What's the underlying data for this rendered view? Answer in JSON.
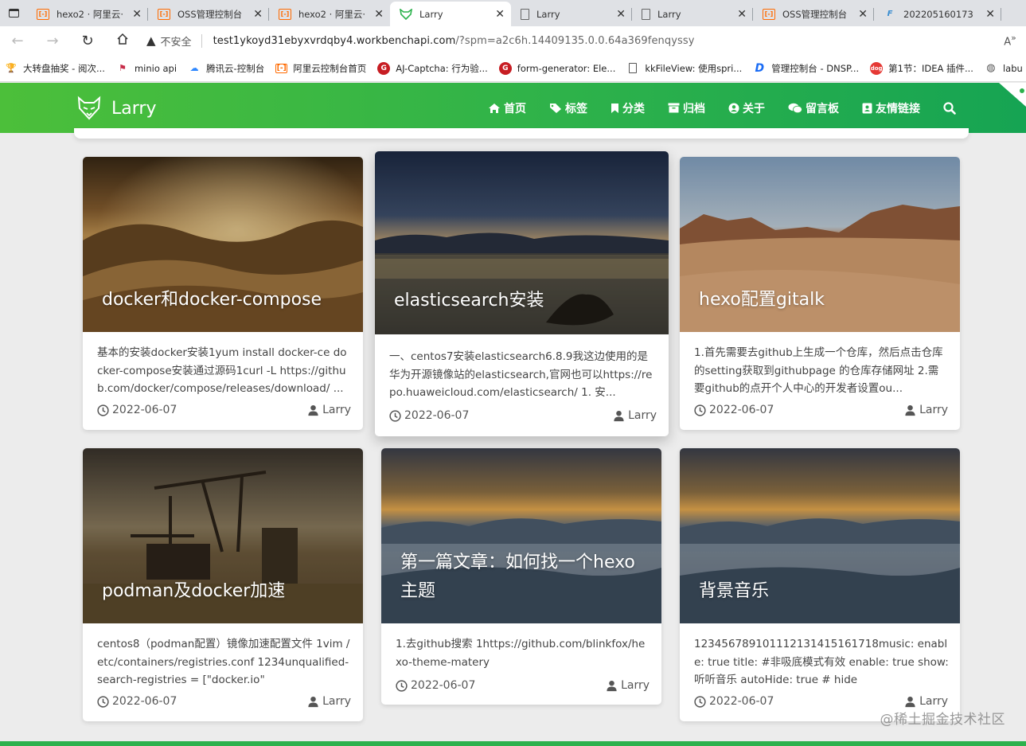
{
  "browser": {
    "tabs": [
      {
        "title": "hexo2 · 阿里云·",
        "favicon": "aliyun-icon",
        "active": false
      },
      {
        "title": "OSS管理控制台",
        "favicon": "aliyun-icon",
        "active": false
      },
      {
        "title": "hexo2 · 阿里云·",
        "favicon": "aliyun-icon",
        "active": false
      },
      {
        "title": "Larry",
        "favicon": "larry-icon",
        "active": true
      },
      {
        "title": "Larry",
        "favicon": "page-icon",
        "active": false
      },
      {
        "title": "Larry",
        "favicon": "page-icon",
        "active": false
      },
      {
        "title": "OSS管理控制台",
        "favicon": "aliyun-icon",
        "active": false
      },
      {
        "title": "202205160173",
        "favicon": "feather-icon",
        "active": false
      }
    ],
    "security_label": "不安全",
    "url_host": "test1ykoyd31ebyxvrdqby4.workbenchapi.com",
    "url_path": "/?spm=a2c6h.14409135.0.0.64a369fenqyssy",
    "bookmarks": [
      {
        "label": "大转盘抽奖 - 阅次...",
        "icon": "trophy-icon"
      },
      {
        "label": "minio api",
        "icon": "bird-icon"
      },
      {
        "label": "腾讯云-控制台",
        "icon": "cloud-icon"
      },
      {
        "label": "阿里云控制台首页",
        "icon": "aliyun-icon"
      },
      {
        "label": "AJ-Captcha: 行为验...",
        "icon": "gitee-icon"
      },
      {
        "label": "form-generator: Ele...",
        "icon": "gitee-icon"
      },
      {
        "label": "kkFileView: 使用spri...",
        "icon": "page-icon"
      },
      {
        "label": "管理控制台 - DNSP...",
        "icon": "dnspod-icon"
      },
      {
        "label": "第1节：IDEA 插件...",
        "icon": "dogo-icon"
      },
      {
        "label": "labu",
        "icon": "globe-icon"
      }
    ]
  },
  "site": {
    "title": "Larry",
    "nav": [
      {
        "label": "首页",
        "icon": "home-icon"
      },
      {
        "label": "标签",
        "icon": "tags-icon"
      },
      {
        "label": "分类",
        "icon": "bookmark-icon"
      },
      {
        "label": "归档",
        "icon": "archive-icon"
      },
      {
        "label": "关于",
        "icon": "user-circle-icon"
      },
      {
        "label": "留言板",
        "icon": "comments-icon"
      },
      {
        "label": "友情链接",
        "icon": "address-book-icon"
      }
    ]
  },
  "posts": [
    {
      "title": "docker和docker-compose",
      "summary": "基本的安装docker安装1yum install docker-ce docker-compose安装通过源码1curl -L https://github.com/docker/compose/releases/download/ ...",
      "date": "2022-06-07",
      "author": "Larry"
    },
    {
      "title": "elasticsearch安装",
      "summary": "一、centos7安装elasticsearch6.8.9我这边使用的是华为开源镜像站的elasticsearch,官网也可以https://repo.huaweicloud.com/elasticsearch/ 1. 安...",
      "date": "2022-06-07",
      "author": "Larry"
    },
    {
      "title": "hexo配置gitalk",
      "summary": "1.首先需要去github上生成一个仓库，然后点击仓库的setting获取到githubpage 的仓库存储网址 2.需要github的点开个人中心的开发者设置ou...",
      "date": "2022-06-07",
      "author": "Larry"
    },
    {
      "title": "podman及docker加速",
      "summary": "centos8（podman配置）镜像加速配置文件 1vim /etc/containers/registries.conf 1234unqualified-search-registries = [\"docker.io\"",
      "date": "2022-06-07",
      "author": "Larry"
    },
    {
      "title": "第一篇文章：如何找一个hexo主题",
      "summary": "1.去github搜索 1https://github.com/blinkfox/hexo-theme-matery",
      "date": "2022-06-07",
      "author": "Larry"
    },
    {
      "title": "背景音乐",
      "summary": "123456789101112131415161718music:   enable: true title: #非吸底模式有效 enable: true show: 听听音乐 autoHide: true # hide",
      "date": "2022-06-07",
      "author": "Larry"
    }
  ],
  "watermark": "@稀土掘金技术社区",
  "colors": {
    "header_start": "#4cbf3a",
    "header_end": "#16a453",
    "accent": "#2db14c"
  }
}
